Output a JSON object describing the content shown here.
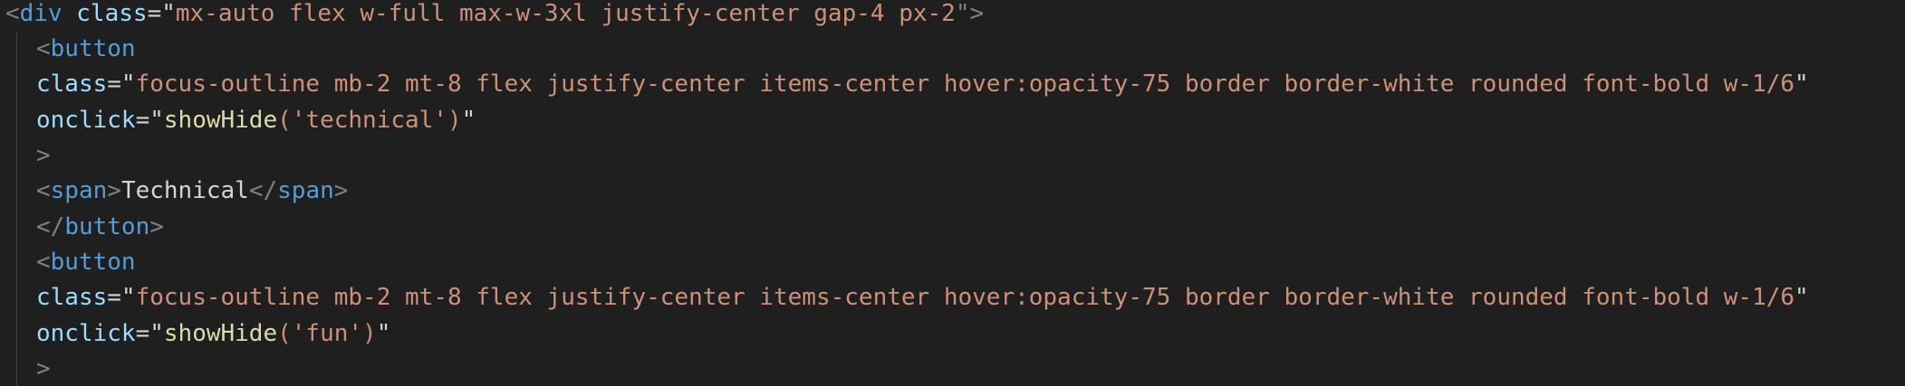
{
  "colors": {
    "background": "#1f1f1f",
    "tag": "#569cd6",
    "attribute": "#9cdcfe",
    "string": "#ce9178",
    "function": "#dcdcaa",
    "punctuation": "#808080",
    "text": "#d4d4d4"
  },
  "code": {
    "line1": {
      "lt": "<",
      "tag": "div",
      "attr": "class",
      "eq": "=\"",
      "value": "mx-auto flex w-full max-w-3xl justify-center gap-4 px-2",
      "end": "\">"
    },
    "line2": {
      "lt": "<",
      "tag": "button"
    },
    "line3": {
      "attr": "class",
      "eq": "=\"",
      "value": "focus-outline mb-2 mt-8 flex justify-center items-center hover:opacity-75 border border-white rounded font-bold w-1/6",
      "end": "\""
    },
    "line4": {
      "attr": "onclick",
      "eq": "=\"",
      "fn": "showHide",
      "args": "('technical')",
      "end": "\""
    },
    "line5": {
      "gt": ">"
    },
    "line6": {
      "open_lt": "<",
      "open_tag": "span",
      "open_gt": ">",
      "text": "Technical",
      "close_lt": "</",
      "close_tag": "span",
      "close_gt": ">"
    },
    "line7": {
      "lt": "</",
      "tag": "button",
      "gt": ">"
    },
    "line8": {
      "lt": "<",
      "tag": "button"
    },
    "line9": {
      "attr": "class",
      "eq": "=\"",
      "value": "focus-outline mb-2 mt-8 flex justify-center items-center hover:opacity-75 border border-white rounded font-bold w-1/6",
      "end": "\""
    },
    "line10": {
      "attr": "onclick",
      "eq": "=\"",
      "fn": "showHide",
      "args": "('fun')",
      "end": "\""
    },
    "line11": {
      "gt": ">"
    }
  }
}
